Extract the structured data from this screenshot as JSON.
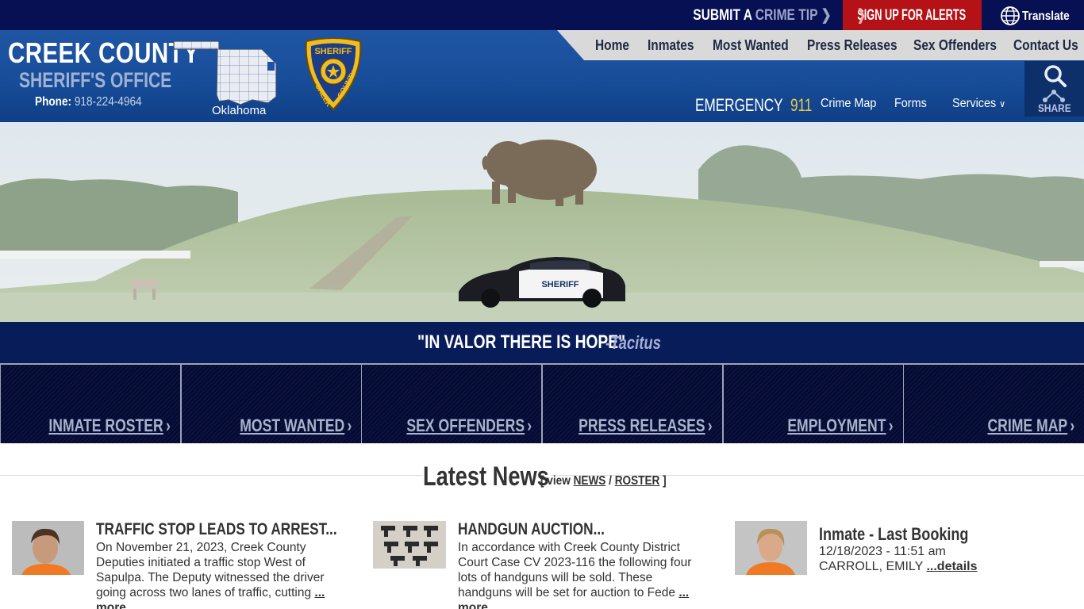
{
  "topbar": {
    "tip_prefix": "SUBMIT A ",
    "tip_highlight": "CRIME TIP",
    "alerts_label": "SIGN UP FOR ALERTS",
    "translate_label": "Translate"
  },
  "header": {
    "brand_line1": "CREEK COUNTY",
    "brand_line2": "SHERIFF'S OFFICE",
    "phone_label": "Phone:",
    "phone_number": "918-224-4964",
    "map_label": "Oklahoma",
    "badge_top": "SHERIFF",
    "badge_left": "CREEK",
    "badge_right": "COUNTY"
  },
  "nav": {
    "items": [
      "Home",
      "Inmates",
      "Most Wanted",
      "Press Releases",
      "Sex Offenders",
      "Contact Us"
    ]
  },
  "subnav": {
    "emergency_label": "EMERGENCY",
    "emergency_number": "911",
    "crime_map": "Crime Map",
    "forms": "Forms",
    "services": "Services",
    "share": "SHARE"
  },
  "hero": {
    "car_text": "SHERIFF"
  },
  "quote": {
    "text": "\"IN VALOR THERE IS HOPE\"",
    "author": "-Tacitus"
  },
  "tiles": [
    "INMATE ROSTER",
    "MOST WANTED",
    "SEX OFFENDERS",
    "PRESS RELEASES",
    "EMPLOYMENT",
    "CRIME MAP"
  ],
  "news": {
    "title": "Latest News",
    "links_prefix": "[ view ",
    "link_news": "NEWS",
    "link_sep": " / ",
    "link_roster": "ROSTER",
    "links_suffix": " ]",
    "items": [
      {
        "title": "TRAFFIC STOP LEADS TO ARREST...",
        "body": "On November 21, 2023, Creek County Deputies initiated a traffic stop West of Sapulpa. The Deputy witnessed the driver going across two lanes of traffic, cutting ",
        "more": "... more"
      },
      {
        "title": "HANDGUN AUCTION...",
        "body": "In accordance with Creek County District Court Case CV 2023-116 the following four lots of handguns will be sold. These handguns will be set for auction to Fede ",
        "more": "... more"
      }
    ],
    "inmate": {
      "title": "Inmate - Last Booking",
      "date": "12/18/2023 - 11:51 am",
      "name": "CARROLL, EMILY ",
      "details": "...details"
    }
  },
  "colors": {
    "topbar": "#071052",
    "header": "#1f56a4",
    "alert": "#b51218",
    "quote_band": "#081c5a",
    "tile": "#050a2e",
    "emergency_number": "#f0c84a"
  }
}
